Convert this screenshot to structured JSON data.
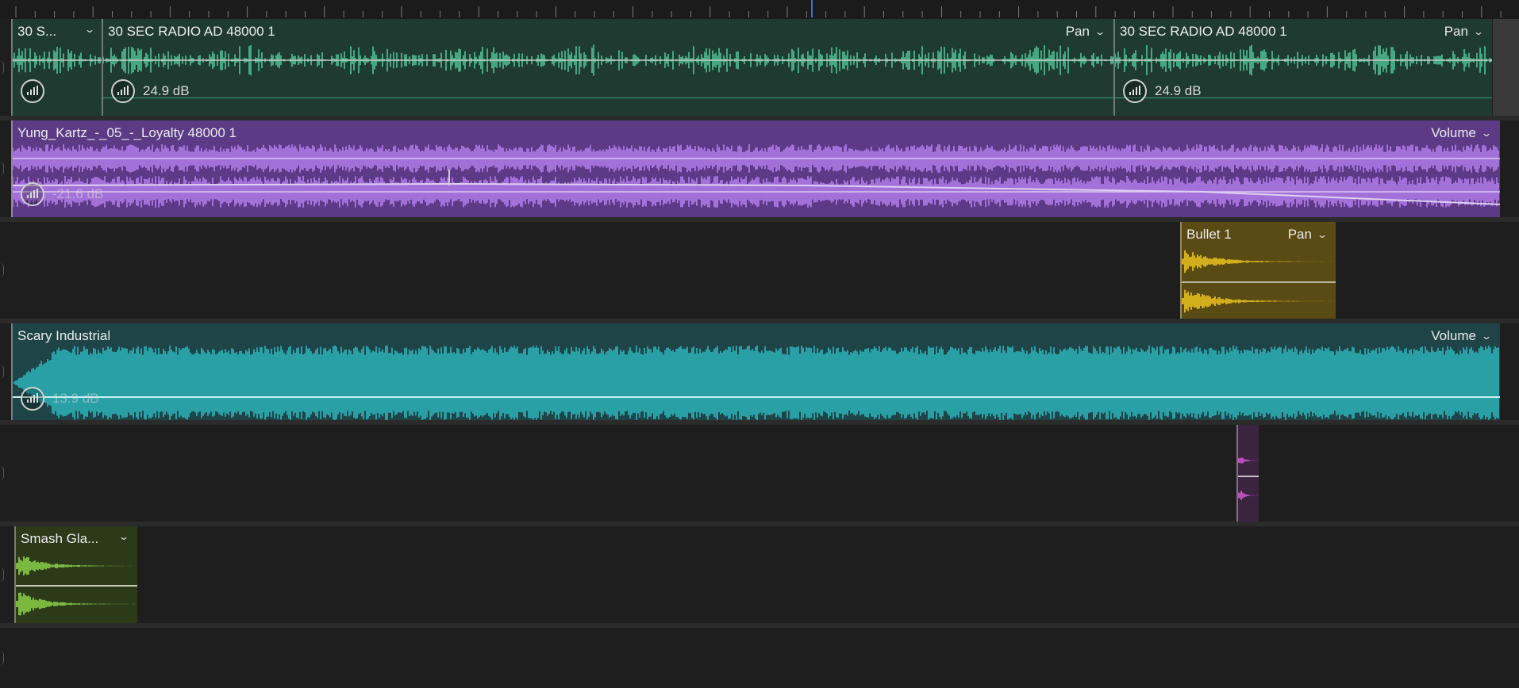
{
  "colors": {
    "dialog": "#1f3a30",
    "dialog_wave": "#4fc39a",
    "music": "#5c3a86",
    "music_wave": "#b57ff0",
    "sfx_yellow": "#5a4a14",
    "sfx_yellow_wave": "#f0c81e",
    "ambience": "#2ab7bd",
    "sfx_pink_wave": "#d65ad6",
    "sfx_green": "#2d3a1a",
    "sfx_green_wave": "#8ed84a"
  },
  "tracks": {
    "dialog": {
      "clips": [
        {
          "title": "30 S...",
          "db": ""
        },
        {
          "title": "30 SEC RADIO AD 48000 1",
          "param": "Pan",
          "db": "24.9 dB"
        },
        {
          "title": "30 SEC RADIO AD 48000 1",
          "param": "Pan",
          "db": "24.9 dB"
        }
      ]
    },
    "music": {
      "title": "Yung_Kartz_-_05_-_Loyalty 48000 1",
      "param": "Volume",
      "db": "-21.6 dB"
    },
    "sfx1": {
      "title": "Bullet 1",
      "param": "Pan"
    },
    "ambience": {
      "title": "Scary Industrial",
      "param": "Volume",
      "db": "13.9 dB"
    },
    "sfx2": {
      "title": ""
    },
    "sfx3": {
      "title": "Smash Gla..."
    }
  },
  "icons": {
    "meter": "volume-meter-icon",
    "chevron": "chevron-down-icon"
  }
}
